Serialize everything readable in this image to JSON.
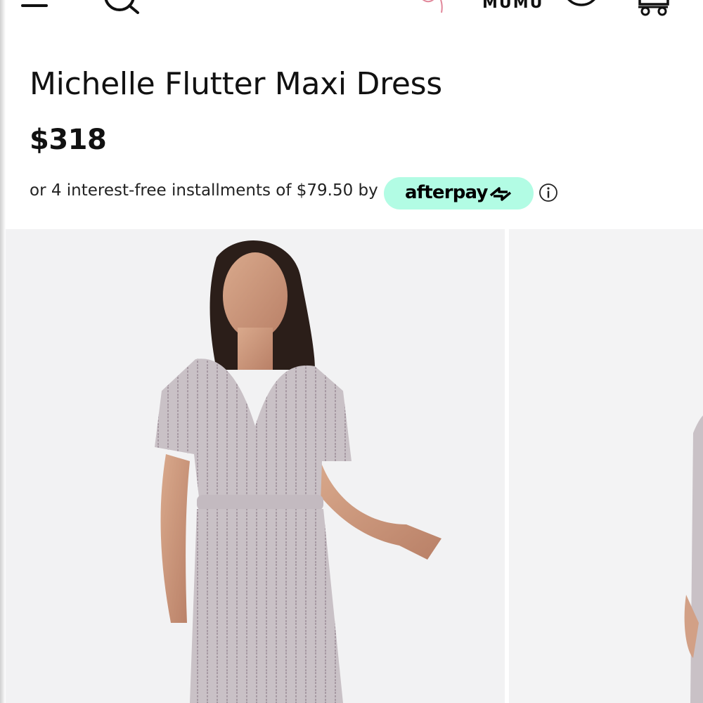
{
  "header": {
    "brand": "MUMU",
    "icons": [
      "menu-icon",
      "search-icon",
      "logo-mark",
      "account-icon",
      "cart-icon"
    ]
  },
  "product": {
    "title": "Michelle Flutter Maxi Dress",
    "price": "$318",
    "installments_text": "or 4 interest-free installments of $79.50 by",
    "afterpay_label": "afterpay",
    "afterpay_color": "#b2fce4"
  },
  "gallery": {
    "images": [
      "model-front-photo",
      "model-side-photo-partial"
    ]
  }
}
